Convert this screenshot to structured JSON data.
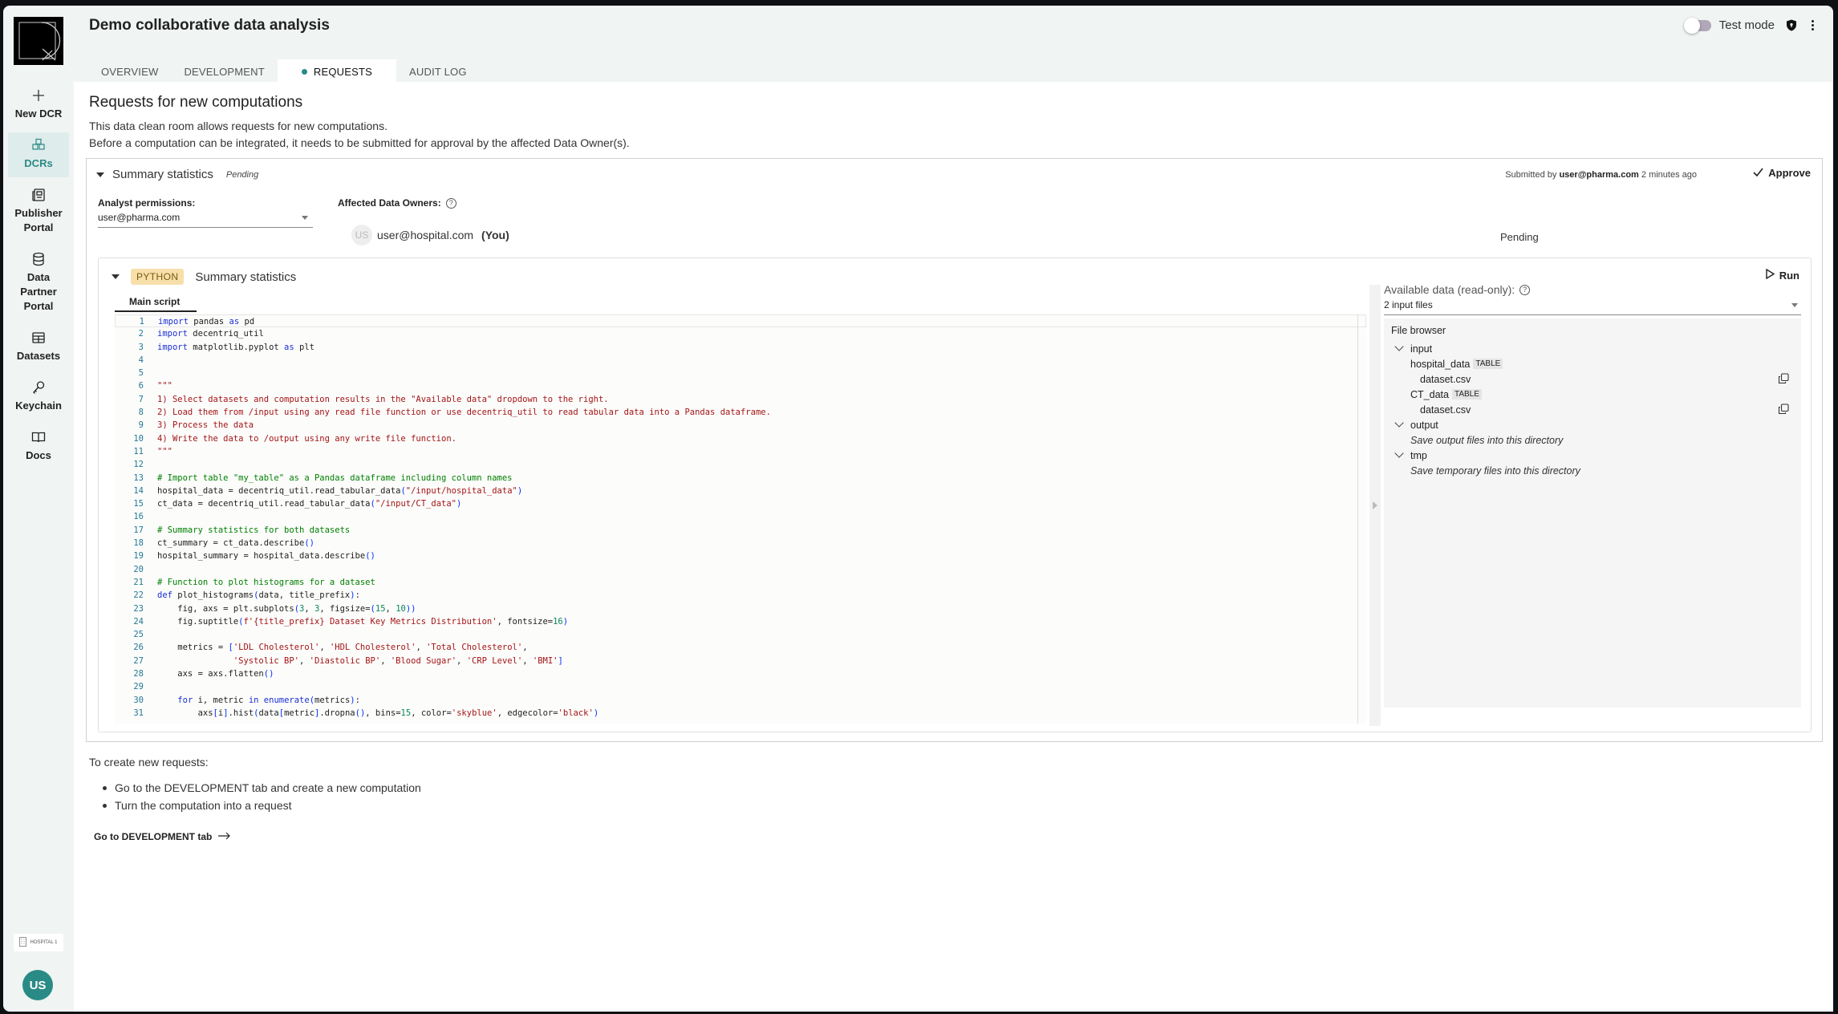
{
  "app": {
    "title": "Demo collaborative data analysis"
  },
  "sidebar": {
    "items": [
      {
        "label": "New DCR",
        "icon": "plus-icon"
      },
      {
        "label": "DCRs",
        "icon": "cubes-icon",
        "active": true
      },
      {
        "label": "Publisher Portal",
        "icon": "newspaper-icon"
      },
      {
        "label": "Data Partner Portal",
        "icon": "database-icon"
      },
      {
        "label": "Datasets",
        "icon": "table-icon"
      },
      {
        "label": "Keychain",
        "icon": "key-icon"
      },
      {
        "label": "Docs",
        "icon": "book-icon"
      }
    ],
    "org_label": "HOSPITAL 1",
    "avatar_initials": "US"
  },
  "header": {
    "test_mode_label": "Test mode",
    "test_mode_on": false,
    "tabs": [
      {
        "label": "OVERVIEW"
      },
      {
        "label": "DEVELOPMENT"
      },
      {
        "label": "REQUESTS",
        "active": true
      },
      {
        "label": "AUDIT LOG"
      }
    ]
  },
  "main": {
    "heading": "Requests for new computations",
    "desc1": "This data clean room allows requests for new computations.",
    "desc2": "Before a computation can be integrated, it needs to be submitted for approval by the affected Data Owner(s).",
    "request": {
      "title": "Summary statistics",
      "status": "Pending",
      "submitted_prefix": "Submitted by",
      "submitted_by": "user@pharma.com",
      "submitted_when": "2 minutes ago",
      "approve_label": "Approve",
      "analyst_permissions_label": "Analyst permissions:",
      "analyst_permissions_value": "user@pharma.com",
      "affected_owners_label": "Affected Data Owners:",
      "owners": [
        {
          "initials": "US",
          "email": "user@hospital.com",
          "you_label": "(You)",
          "status": "Pending"
        }
      ],
      "computation": {
        "language_badge": "PYTHON",
        "title": "Summary statistics",
        "run_label": "Run",
        "script_tab": "Main script",
        "available_label": "Available data (read-only):",
        "available_value": "2 input files",
        "file_browser": {
          "title": "File browser",
          "input_folder": "input",
          "tables": [
            {
              "name": "hospital_data",
              "badge": "TABLE",
              "file": "dataset.csv"
            },
            {
              "name": "CT_data",
              "badge": "TABLE",
              "file": "dataset.csv"
            }
          ],
          "output_folder": "output",
          "output_hint": "Save output files into this directory",
          "tmp_folder": "tmp",
          "tmp_hint": "Save temporary files into this directory"
        },
        "code_lines": [
          "import pandas as pd",
          "import decentriq_util",
          "import matplotlib.pyplot as plt",
          "",
          "",
          "\"\"\"",
          "1) Select datasets and computation results in the \"Available data\" dropdown to the right.",
          "2) Load them from /input using any read file function or use decentriq_util to read tabular data into a Pandas dataframe.",
          "3) Process the data",
          "4) Write the data to /output using any write file function.",
          "\"\"\"",
          "",
          "# Import table \"my_table\" as a Pandas dataframe including column names",
          "hospital_data = decentriq_util.read_tabular_data(\"/input/hospital_data\")",
          "ct_data = decentriq_util.read_tabular_data(\"/input/CT_data\")",
          "",
          "# Summary statistics for both datasets",
          "ct_summary = ct_data.describe()",
          "hospital_summary = hospital_data.describe()",
          "",
          "# Function to plot histograms for a dataset",
          "def plot_histograms(data, title_prefix):",
          "    fig, axs = plt.subplots(3, 3, figsize=(15, 10))",
          "    fig.suptitle(f'{title_prefix} Dataset Key Metrics Distribution', fontsize=16)",
          "",
          "    metrics = ['LDL Cholesterol', 'HDL Cholesterol', 'Total Cholesterol',",
          "               'Systolic BP', 'Diastolic BP', 'Blood Sugar', 'CRP Level', 'BMI']",
          "    axs = axs.flatten()",
          "",
          "    for i, metric in enumerate(metrics):",
          "        axs[i].hist(data[metric].dropna(), bins=15, color='skyblue', edgecolor='black')"
        ]
      }
    },
    "create_heading": "To create new requests:",
    "create_steps": [
      "Go to the DEVELOPMENT tab and create a new computation",
      "Turn the computation into a request"
    ],
    "go_link": "Go to DEVELOPMENT tab"
  }
}
